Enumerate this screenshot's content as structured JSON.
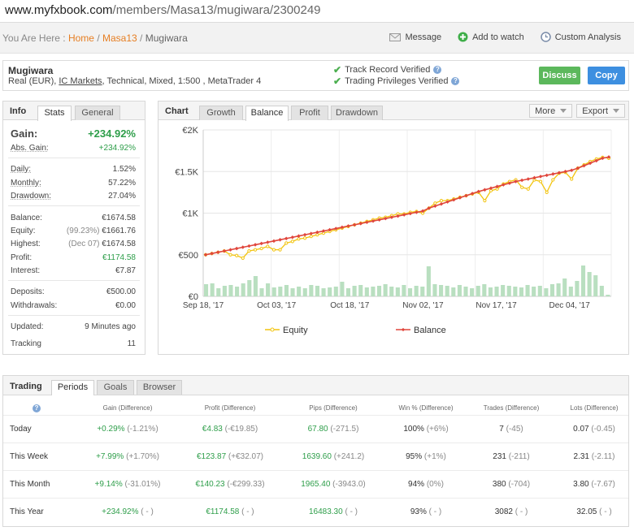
{
  "browser": {
    "url_host": "www.myfxbook.com",
    "url_path": "/members/Masa13/mugiwara/2300249"
  },
  "breadcrumb": {
    "prefix": "You Are Here :",
    "home": "Home",
    "member": "Masa13",
    "current": "Mugiwara",
    "sep": "/"
  },
  "actions": {
    "message": "Message",
    "add_watch": "Add to watch",
    "custom": "Custom Analysis"
  },
  "account": {
    "name": "Mugiwara",
    "desc_pre": "Real (EUR),",
    "broker": "IC Markets",
    "desc_post": ", Technical, Mixed, 1:500 , MetaTrader 4",
    "track_record": "Track Record Verified",
    "trading_priv": "Trading Privileges Verified",
    "discuss": "Discuss",
    "copy": "Copy"
  },
  "info": {
    "title": "Info",
    "tabs": [
      "Stats",
      "General"
    ],
    "gain_label": "Gain:",
    "gain": "+234.92%",
    "abs_gain_label": "Abs. Gain:",
    "abs_gain": "+234.92%",
    "daily_label": "Daily:",
    "daily": "1.52%",
    "monthly_label": "Monthly:",
    "monthly": "57.22%",
    "drawdown_label": "Drawdown:",
    "drawdown": "27.04%",
    "balance_label": "Balance:",
    "balance": "€1674.58",
    "equity_label": "Equity:",
    "equity_pct": "(99.23%)",
    "equity": "€1661.76",
    "highest_label": "Highest:",
    "highest_date": "(Dec 07)",
    "highest": "€1674.58",
    "profit_label": "Profit:",
    "profit": "€1174.58",
    "interest_label": "Interest:",
    "interest": "€7.87",
    "deposits_label": "Deposits:",
    "deposits": "€500.00",
    "withdrawals_label": "Withdrawals:",
    "withdrawals": "€0.00",
    "updated_label": "Updated:",
    "updated": "9 Minutes ago",
    "tracking_label": "Tracking",
    "tracking": "11"
  },
  "chart": {
    "title": "Chart",
    "tabs": [
      "Growth",
      "Balance",
      "Profit",
      "Drawdown"
    ],
    "more": "More",
    "export": "Export"
  },
  "chart_data": {
    "type": "line",
    "x_labels": [
      "Sep 18, '17",
      "Oct 03, '17",
      "Oct 18, '17",
      "Nov 02, '17",
      "Nov 17, '17",
      "Dec 04, '17"
    ],
    "y_ticks": [
      "€0",
      "€500",
      "€1K",
      "€1.5K",
      "€2K"
    ],
    "ylim": [
      0,
      2000
    ],
    "grid": true,
    "legend_position": "bottom",
    "series": [
      {
        "name": "Equity",
        "color": "#f2c40f",
        "values": [
          500,
          515,
          530,
          545,
          500,
          490,
          460,
          545,
          560,
          575,
          600,
          560,
          560,
          640,
          660,
          690,
          700,
          720,
          740,
          760,
          780,
          800,
          820,
          840,
          860,
          880,
          900,
          920,
          940,
          950,
          970,
          990,
          990,
          1010,
          1020,
          1000,
          1060,
          1120,
          1150,
          1150,
          1170,
          1190,
          1210,
          1230,
          1250,
          1150,
          1270,
          1290,
          1350,
          1380,
          1400,
          1310,
          1290,
          1400,
          1380,
          1250,
          1400,
          1480,
          1490,
          1410,
          1540,
          1580,
          1620,
          1650,
          1670,
          1660
        ]
      },
      {
        "name": "Balance",
        "color": "#e0463c",
        "values": [
          500,
          515,
          530,
          545,
          560,
          575,
          590,
          605,
          620,
          635,
          650,
          665,
          680,
          695,
          710,
          725,
          740,
          755,
          770,
          785,
          800,
          815,
          830,
          845,
          860,
          875,
          890,
          905,
          920,
          935,
          950,
          965,
          980,
          995,
          1010,
          1025,
          1060,
          1085,
          1110,
          1135,
          1160,
          1185,
          1210,
          1235,
          1260,
          1280,
          1300,
          1320,
          1340,
          1360,
          1380,
          1395,
          1410,
          1425,
          1440,
          1455,
          1470,
          1485,
          1500,
          1515,
          1540,
          1570,
          1600,
          1630,
          1660,
          1674.58
        ]
      }
    ],
    "volume_values": [
      150,
      160,
      100,
      130,
      140,
      120,
      160,
      200,
      250,
      100,
      160,
      110,
      120,
      140,
      100,
      120,
      100,
      140,
      130,
      100,
      110,
      120,
      180,
      100,
      130,
      140,
      110,
      120,
      130,
      150,
      120,
      110,
      140,
      100,
      130,
      120,
      370,
      150,
      140,
      130,
      110,
      140,
      120,
      100,
      130,
      150,
      110,
      120,
      140,
      130,
      120,
      110,
      140,
      120,
      130,
      100,
      150,
      160,
      220,
      120,
      190,
      380,
      300,
      260,
      130,
      20
    ]
  },
  "trading": {
    "title": "Trading",
    "tabs": [
      "Periods",
      "Goals",
      "Browser"
    ],
    "columns": [
      "Gain (Difference)",
      "Profit (Difference)",
      "Pips (Difference)",
      "Win % (Difference)",
      "Trades (Difference)",
      "Lots (Difference)"
    ],
    "rows": [
      {
        "period": "Today",
        "gain": "+0.29%",
        "gain_diff": "(-1.21%)",
        "profit": "€4.83",
        "profit_diff": "(-€19.85)",
        "pips": "67.80",
        "pips_diff": "(-271.5)",
        "win": "100%",
        "win_diff": "(+6%)",
        "trades": "7",
        "trades_diff": "(-45)",
        "lots": "0.07",
        "lots_diff": "(-0.45)"
      },
      {
        "period": "This Week",
        "gain": "+7.99%",
        "gain_diff": "(+1.70%)",
        "profit": "€123.87",
        "profit_diff": "(+€32.07)",
        "pips": "1639.60",
        "pips_diff": "(+241.2)",
        "win": "95%",
        "win_diff": "(+1%)",
        "trades": "231",
        "trades_diff": "(-211)",
        "lots": "2.31",
        "lots_diff": "(-2.11)"
      },
      {
        "period": "This Month",
        "gain": "+9.14%",
        "gain_diff": "(-31.01%)",
        "profit": "€140.23",
        "profit_diff": "(-€299.33)",
        "pips": "1965.40",
        "pips_diff": "(-3943.0)",
        "win": "94%",
        "win_diff": "(0%)",
        "trades": "380",
        "trades_diff": "(-704)",
        "lots": "3.80",
        "lots_diff": "(-7.67)"
      },
      {
        "period": "This Year",
        "gain": "+234.92%",
        "gain_diff": "( - )",
        "profit": "€1174.58",
        "profit_diff": "( - )",
        "pips": "16483.30",
        "pips_diff": "( - )",
        "win": "93%",
        "win_diff": "( - )",
        "trades": "3082",
        "trades_diff": "( - )",
        "lots": "32.05",
        "lots_diff": "( - )"
      }
    ]
  }
}
